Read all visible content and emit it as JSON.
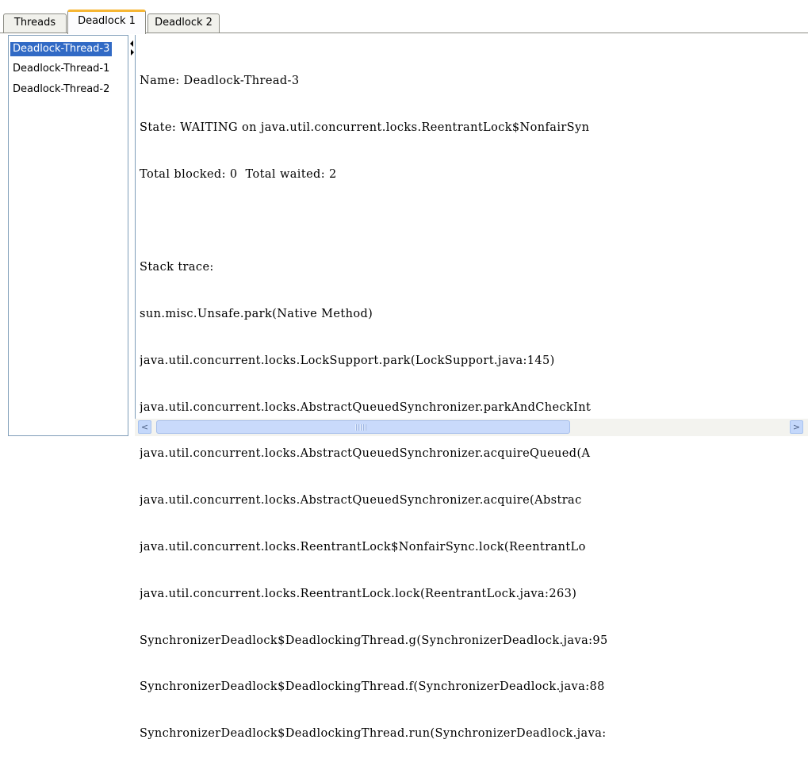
{
  "tabs": [
    {
      "label": "Threads",
      "selected": false
    },
    {
      "label": "Deadlock 1",
      "selected": true
    },
    {
      "label": "Deadlock 2",
      "selected": false
    }
  ],
  "thread_list": {
    "items": [
      {
        "label": "Deadlock-Thread-3",
        "selected": true
      },
      {
        "label": "Deadlock-Thread-1",
        "selected": false
      },
      {
        "label": "Deadlock-Thread-2",
        "selected": false
      }
    ]
  },
  "detail": {
    "lines": [
      "Name: Deadlock-Thread-3",
      "State: WAITING on java.util.concurrent.locks.ReentrantLock$NonfairSyn",
      "Total blocked: 0  Total waited: 2",
      "",
      "Stack trace:",
      "sun.misc.Unsafe.park(Native Method)",
      "java.util.concurrent.locks.LockSupport.park(LockSupport.java:145)",
      "java.util.concurrent.locks.AbstractQueuedSynchronizer.parkAndCheckInt",
      "java.util.concurrent.locks.AbstractQueuedSynchronizer.acquireQueued(A",
      "java.util.concurrent.locks.AbstractQueuedSynchronizer.acquire(Abstrac",
      "java.util.concurrent.locks.ReentrantLock$NonfairSync.lock(ReentrantLo",
      "java.util.concurrent.locks.ReentrantLock.lock(ReentrantLock.java:263)",
      "SynchronizerDeadlock$DeadlockingThread.g(SynchronizerDeadlock.java:95",
      "SynchronizerDeadlock$DeadlockingThread.f(SynchronizerDeadlock.java:88",
      "SynchronizerDeadlock$DeadlockingThread.run(SynchronizerDeadlock.java:"
    ]
  },
  "scrollbar": {
    "left_icon": "arrow-left-icon",
    "right_icon": "arrow-right-icon",
    "left_glyph": "<",
    "right_glyph": ">"
  },
  "colors": {
    "selection": "#316ac5",
    "tab_accent": "#f6b634"
  }
}
